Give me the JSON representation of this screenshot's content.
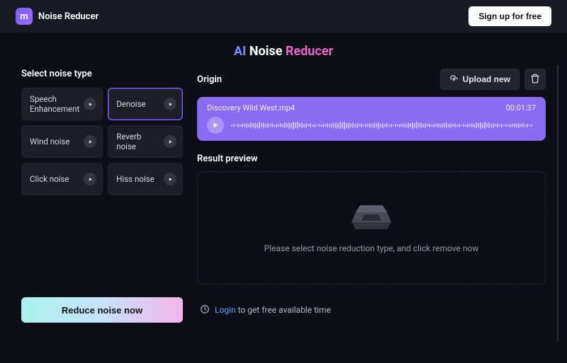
{
  "brand": {
    "name": "Noise Reducer",
    "logo_glyph": "m"
  },
  "topbar": {
    "signup_label": "Sign up for free"
  },
  "hero": {
    "prefix": "AI ",
    "mid": "Noise ",
    "suffix": "Reducer"
  },
  "left": {
    "heading": "Select noise type",
    "types": [
      {
        "label": "Speech Enhancement",
        "selected": false
      },
      {
        "label": "Denoise",
        "selected": true
      },
      {
        "label": "Wind noise",
        "selected": false
      },
      {
        "label": "Reverb noise",
        "selected": false
      },
      {
        "label": "Click noise",
        "selected": false
      },
      {
        "label": "Hiss noise",
        "selected": false
      }
    ]
  },
  "origin": {
    "heading": "Origin",
    "upload_label": "Upload new",
    "file_name": "Discovery Wild West.mp4",
    "duration": "00:01:37"
  },
  "result": {
    "heading": "Result preview",
    "placeholder": "Please select noise reduction type, and click remove now"
  },
  "footer": {
    "cta_label": "Reduce noise now",
    "login_link": "Login",
    "login_rest": " to get free available time"
  },
  "colors": {
    "accent": "#8a6cf3"
  }
}
